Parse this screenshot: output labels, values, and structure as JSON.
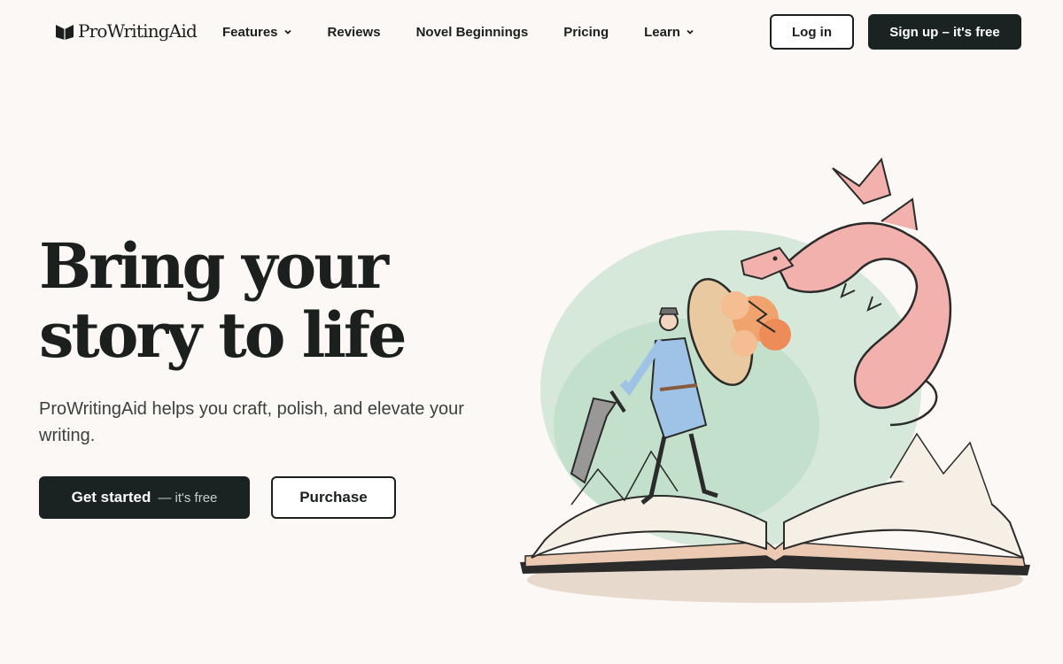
{
  "nav": {
    "logo_text": "ProWritingAid",
    "links": [
      {
        "label": "Features",
        "has_dropdown": true
      },
      {
        "label": "Reviews",
        "has_dropdown": false
      },
      {
        "label": "Novel Beginnings",
        "has_dropdown": false
      },
      {
        "label": "Pricing",
        "has_dropdown": false
      },
      {
        "label": "Learn",
        "has_dropdown": true
      }
    ],
    "login_label": "Log in",
    "signup_label": "Sign up – it's free"
  },
  "hero": {
    "headline_line1": "Bring your",
    "headline_line2": "story to life",
    "subtext": "ProWritingAid helps you craft, polish, and elevate your writing.",
    "primary_button": {
      "label": "Get started",
      "suffix": "— it's free"
    },
    "secondary_button_label": "Purchase",
    "illustration": "book-knight-dragon-illustration"
  },
  "colors": {
    "background": "#fcf8f5",
    "text": "#1b1f1d",
    "button_dark": "#1b2322",
    "dragon": "#f2a7a4",
    "fire": "#f0894f",
    "splash": "#b9dcc2"
  }
}
